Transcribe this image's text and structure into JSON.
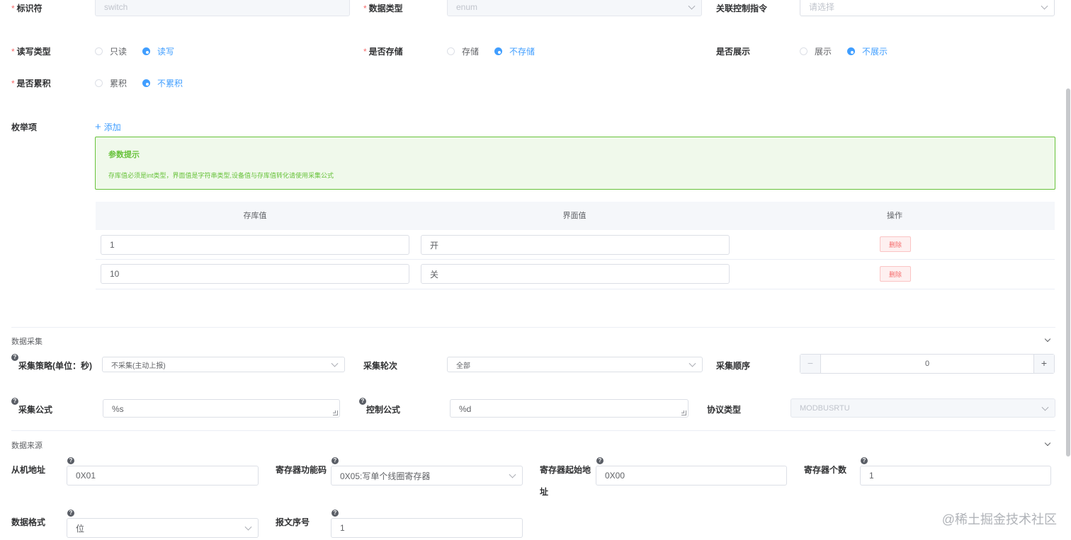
{
  "row1": {
    "identifier": {
      "label": "标识符",
      "value": "switch"
    },
    "data_type": {
      "label": "数据类型",
      "value": "enum"
    },
    "linked_command": {
      "label": "关联控制指令",
      "placeholder": "请选择"
    }
  },
  "row2": {
    "rw_type": {
      "label": "读写类型",
      "options": [
        "只读",
        "读写"
      ],
      "selected": "读写"
    },
    "stored": {
      "label": "是否存储",
      "options": [
        "存储",
        "不存储"
      ],
      "selected": "不存储"
    },
    "displayed": {
      "label": "是否展示",
      "options": [
        "展示",
        "不展示"
      ],
      "selected": "不展示"
    }
  },
  "row3": {
    "accumulate": {
      "label": "是否累积",
      "options": [
        "累积",
        "不累积"
      ],
      "selected": "不累积"
    }
  },
  "enum": {
    "label": "枚举项",
    "add_label": "添加",
    "alert_title": "参数提示",
    "alert_desc": "存库值必须是int类型，界面值是字符串类型,设备值与存库值转化请使用采集公式",
    "columns": [
      "存库值",
      "界面值",
      "操作"
    ],
    "rows": [
      {
        "stored": "1",
        "display": "开",
        "action": "删除"
      },
      {
        "stored": "10",
        "display": "关",
        "action": "删除"
      }
    ]
  },
  "collection": {
    "section_title": "数据采集",
    "strategy": {
      "label": "采集策略(单位：秒)",
      "value": "不采集(主动上报)"
    },
    "round": {
      "label": "采集轮次",
      "value": "全部"
    },
    "order": {
      "label": "采集顺序",
      "value": "0",
      "minus": "−",
      "plus": "+"
    },
    "formula": {
      "label": "采集公式",
      "value": "%s"
    },
    "control_formula": {
      "label": "控制公式",
      "value": "%d"
    },
    "protocol": {
      "label": "协议类型",
      "value": "MODBUSRTU"
    }
  },
  "source": {
    "section_title": "数据来源",
    "slave_addr": {
      "label": "从机地址",
      "value": "0X01"
    },
    "func_code": {
      "label": "寄存器功能码",
      "value": "0X05:写单个线圈寄存器"
    },
    "start_addr": {
      "label_line1": "寄存器起始地",
      "label_line2": "址",
      "value": "0X00"
    },
    "reg_count": {
      "label": "寄存器个数",
      "value": "1"
    },
    "data_format": {
      "label": "数据格式",
      "value": "位"
    },
    "msg_seq": {
      "label": "报文序号",
      "value": "1"
    }
  },
  "watermark": "@稀土掘金技术社区",
  "colors": {
    "primary": "#409eff",
    "danger": "#f56c6c",
    "success": "#67c23a"
  }
}
